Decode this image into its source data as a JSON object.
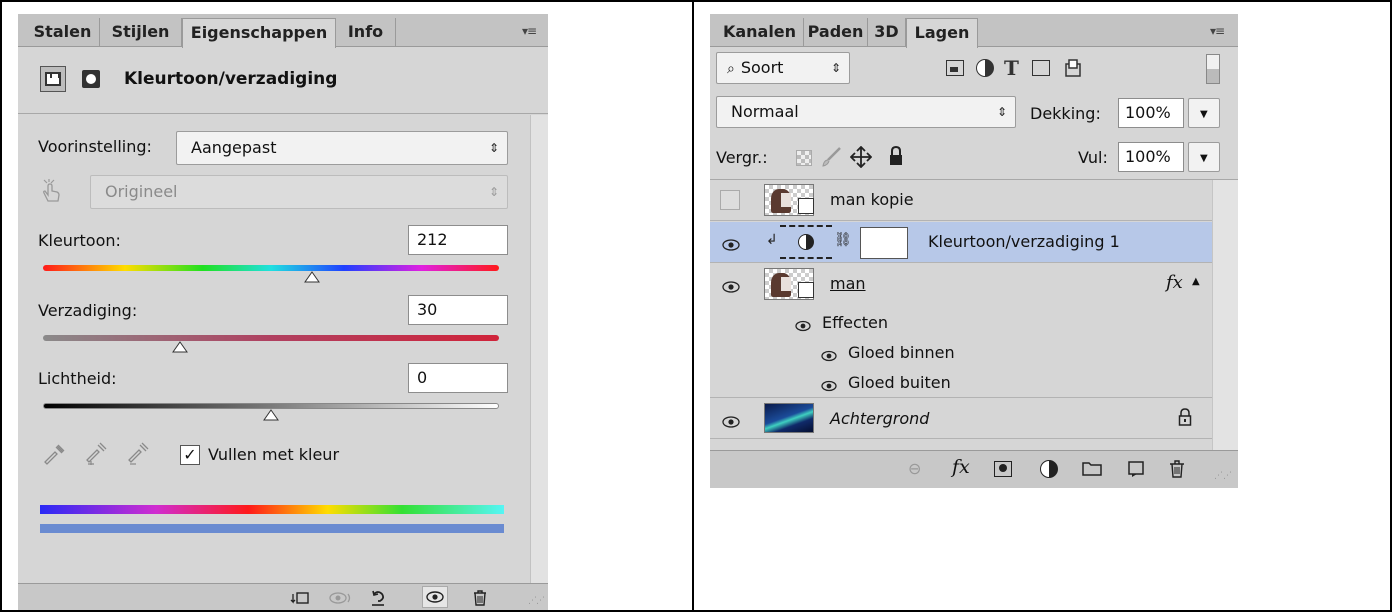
{
  "properties_panel": {
    "tabs": [
      "Stalen",
      "Stijlen",
      "Eigenschappen",
      "Info"
    ],
    "active_tab": "Eigenschappen",
    "title": "Kleurtoon/verzadiging",
    "preset_label": "Voorinstelling:",
    "preset_value": "Aangepast",
    "range_value": "Origineel",
    "hue_label": "Kleurtoon:",
    "hue_value": "212",
    "hue_position": 0.59,
    "saturation_label": "Verzadiging:",
    "saturation_value": "30",
    "saturation_position": 0.3,
    "lightness_label": "Lichtheid:",
    "lightness_value": "0",
    "lightness_position": 0.5,
    "colorize_label": "Vullen met kleur",
    "colorize_checked": true,
    "checkmark": "✓"
  },
  "layers_panel": {
    "tabs": [
      "Kanalen",
      "Paden",
      "3D",
      "Lagen"
    ],
    "active_tab": "Lagen",
    "filter_label": "Soort",
    "blend_mode": "Normaal",
    "opacity_label": "Dekking:",
    "opacity_value": "100%",
    "lock_label": "Vergr.:",
    "fill_label": "Vul:",
    "fill_value": "100%",
    "layers": [
      {
        "name": "man kopie",
        "visible": false
      },
      {
        "name": "Kleurtoon/verzadiging 1",
        "visible": true,
        "selected": true
      },
      {
        "name": "man",
        "visible": true,
        "fx": "fx"
      },
      {
        "name": "Achtergrond",
        "visible": true,
        "locked": true
      }
    ],
    "effects_label": "Effecten",
    "effects": [
      "Gloed binnen",
      "Gloed buiten"
    ],
    "footer_fx": "fx"
  },
  "colors": {
    "panel_bg": "#d6d6d6",
    "tab_bar": "#c3c3c3",
    "selection": "#b7c8e8",
    "bottom_bar": "#6a8bd1",
    "saturation_track_end": "#d0233a"
  }
}
